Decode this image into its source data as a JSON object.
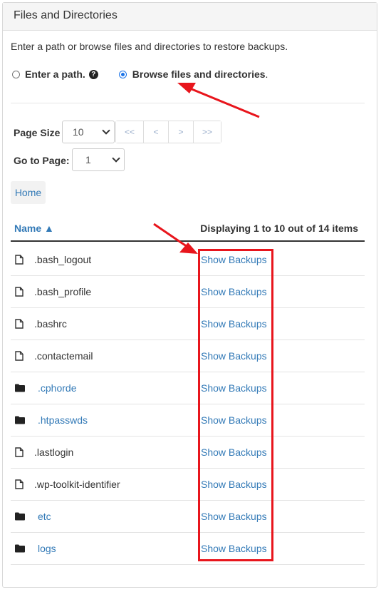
{
  "panel": {
    "title": "Files and Directories"
  },
  "intro": "Enter a path or browse files and directories to restore backups.",
  "options": {
    "enter_path": "Enter a path.",
    "browse": "Browse files and directories",
    "browse_suffix": ".",
    "selected": "browse"
  },
  "paging": {
    "page_size_label": "Page Size",
    "page_size_value": "10",
    "go_to_label": "Go to Page:",
    "page_value": "1",
    "buttons": [
      "<<",
      "<",
      ">",
      ">>"
    ]
  },
  "breadcrumb": {
    "home": "Home"
  },
  "table": {
    "name_header": "Name ▲",
    "display_text": "Displaying 1 to 10 out of 14 items",
    "rows": [
      {
        "name": ".bash_logout",
        "type": "file",
        "action": "Show Backups"
      },
      {
        "name": ".bash_profile",
        "type": "file",
        "action": "Show Backups"
      },
      {
        "name": ".bashrc",
        "type": "file",
        "action": "Show Backups"
      },
      {
        "name": ".contactemail",
        "type": "file",
        "action": "Show Backups"
      },
      {
        "name": ".cphorde",
        "type": "folder",
        "action": "Show Backups"
      },
      {
        "name": ".htpasswds",
        "type": "folder",
        "action": "Show Backups"
      },
      {
        "name": ".lastlogin",
        "type": "file",
        "action": "Show Backups"
      },
      {
        "name": ".wp-toolkit-identifier",
        "type": "file",
        "action": "Show Backups"
      },
      {
        "name": "etc",
        "type": "folder",
        "action": "Show Backups"
      },
      {
        "name": "logs",
        "type": "folder",
        "action": "Show Backups"
      }
    ]
  },
  "colors": {
    "link": "#337ab7",
    "annotation": "#e8151c"
  }
}
